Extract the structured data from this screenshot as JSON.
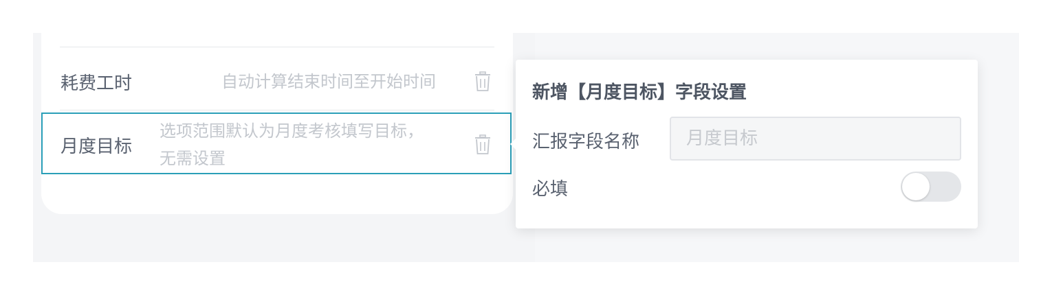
{
  "fields": [
    {
      "label": "耗费工时",
      "hint": "自动计算结束时间至开始时间",
      "delete_icon": "trash-icon"
    },
    {
      "label": "月度目标",
      "hint_line1": "选项范围默认为月度考核填写目标，",
      "hint_line2": "无需设置",
      "delete_icon": "trash-icon",
      "selected": true
    }
  ],
  "popover": {
    "title": "新增【月度目标】字段设置",
    "name_label": "汇报字段名称",
    "name_placeholder": "月度目标",
    "required_label": "必填",
    "required_on": false
  },
  "colors": {
    "accent": "#2a9fb8",
    "label": "#5a6270",
    "hint": "#c3c7cd",
    "background": "#f4f5f7"
  }
}
